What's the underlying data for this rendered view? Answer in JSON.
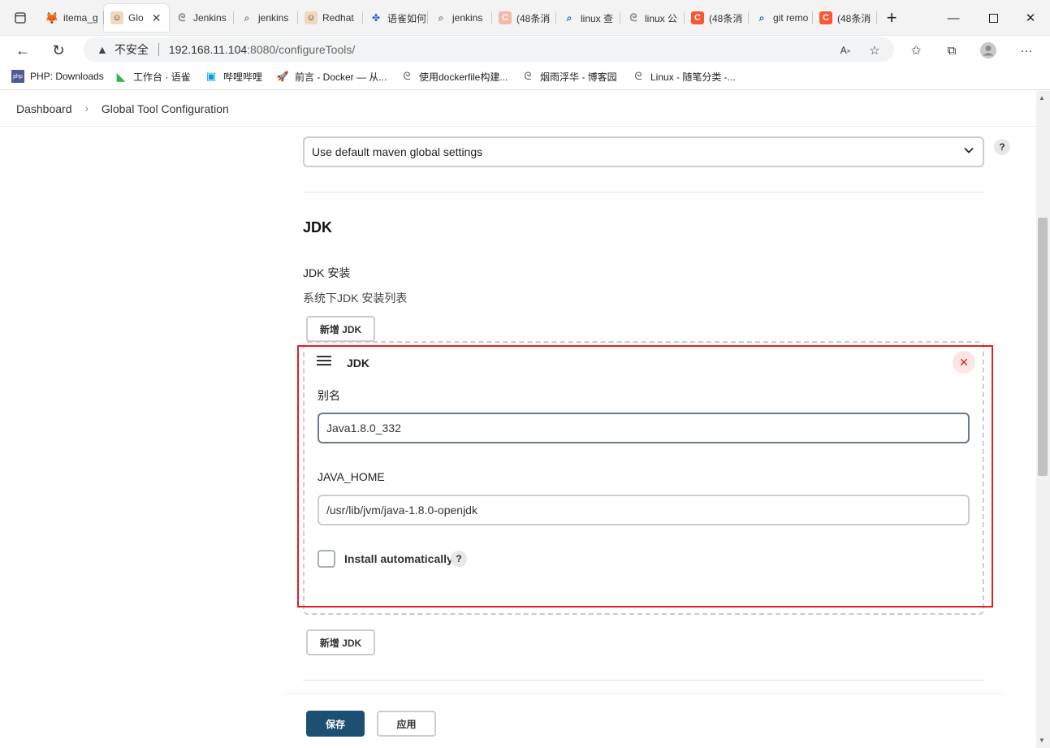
{
  "browser": {
    "tabs": [
      {
        "label": "itema_g",
        "icon": "gitlab-icon",
        "color": "#e24329"
      },
      {
        "label": "Glo",
        "icon": "jenkins-icon",
        "color": "#d33833",
        "active": true
      },
      {
        "label": "Jenkins",
        "icon": "jenkins-swirl-icon",
        "color": "#888888"
      },
      {
        "label": "jenkins",
        "icon": "search-icon",
        "color": "#888888"
      },
      {
        "label": "Redhat",
        "icon": "jenkins-icon",
        "color": "#d33833"
      },
      {
        "label": "语雀如何",
        "icon": "paw-icon",
        "color": "#3066e0"
      },
      {
        "label": "jenkins",
        "icon": "search-icon",
        "color": "#888888"
      },
      {
        "label": "(48条消",
        "icon": "csdn-icon",
        "color": "#fc5531"
      },
      {
        "label": "linux 查",
        "icon": "search-icon",
        "color": "#3066e0"
      },
      {
        "label": "linux 公",
        "icon": "jenkins-swirl-icon",
        "color": "#888888"
      },
      {
        "label": "(48条消",
        "icon": "csdn-icon",
        "color": "#fc5531"
      },
      {
        "label": "git remo",
        "icon": "search-icon",
        "color": "#3066e0"
      },
      {
        "label": "(48条消",
        "icon": "csdn-icon",
        "color": "#fc5531"
      }
    ],
    "insecure_label": "不安全",
    "url_host": "192.168.11.104",
    "url_rest": ":8080/configureTools/",
    "bookmarks": [
      {
        "label": "PHP: Downloads",
        "icon": "php-icon"
      },
      {
        "label": "工作台 · 语雀",
        "icon": "yuque-icon"
      },
      {
        "label": "哔哩哔哩",
        "icon": "bilibili-icon"
      },
      {
        "label": "前言 - Docker — 从...",
        "icon": "rocket-icon"
      },
      {
        "label": "使用dockerfile构建...",
        "icon": "cnblogs-icon"
      },
      {
        "label": "烟雨浮华 - 博客园",
        "icon": "cnblogs-icon"
      },
      {
        "label": "Linux - 随笔分类 -...",
        "icon": "cnblogs-icon"
      }
    ]
  },
  "breadcrumb": {
    "home": "Dashboard",
    "current": "Global Tool Configuration"
  },
  "maven": {
    "global_settings_value": "Use default maven global settings"
  },
  "jdk": {
    "section_title": "JDK",
    "install_label": "JDK 安装",
    "install_desc": "系统下JDK 安装列表",
    "add_button": "新增 JDK",
    "card_title": "JDK",
    "alias_label": "别名",
    "alias_value": "Java1.8.0_332",
    "java_home_label": "JAVA_HOME",
    "java_home_value": "/usr/lib/jvm/java-1.8.0-openjdk",
    "install_auto_label": "Install automatically",
    "install_auto_checked": false
  },
  "footer": {
    "save_label": "保存",
    "apply_label": "应用"
  },
  "help_glyph": "?"
}
